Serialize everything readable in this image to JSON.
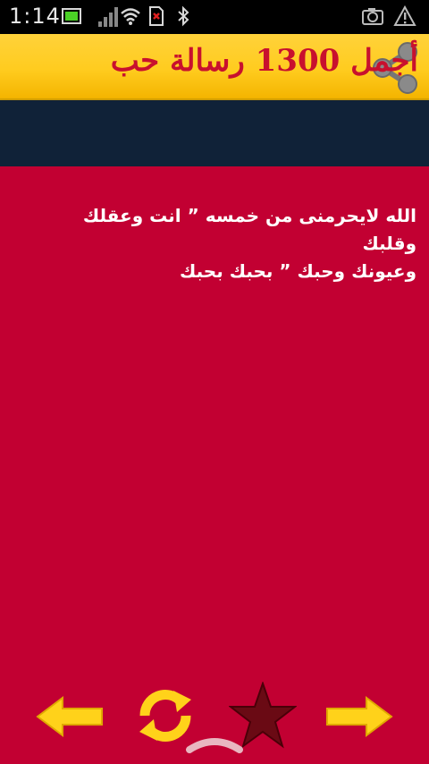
{
  "status_bar": {
    "time": "1:14",
    "icons": [
      "screen-icon",
      "signal-icon",
      "wifi-icon",
      "sim-icon",
      "bluetooth-icon",
      "camera-icon",
      "warning-icon"
    ]
  },
  "header": {
    "title": "أجمل 1300 رسالة حب",
    "share_icon": "share-icon"
  },
  "message": {
    "text": "الله لايحرمنى من خمسه ” انت وعقلك وقلبك\nوعيونك وحبك ” بحبك بحبك"
  },
  "bottom_bar": {
    "buttons": [
      "arrow-left-icon",
      "refresh-icon",
      "star-icon",
      "arrow-right-icon"
    ]
  },
  "colors": {
    "header_bg": "#ffcc1f",
    "title": "#c8102e",
    "band": "#102238",
    "content_bg": "#c20032",
    "arrow": "#ffd21a",
    "star": "#6a0a14"
  }
}
